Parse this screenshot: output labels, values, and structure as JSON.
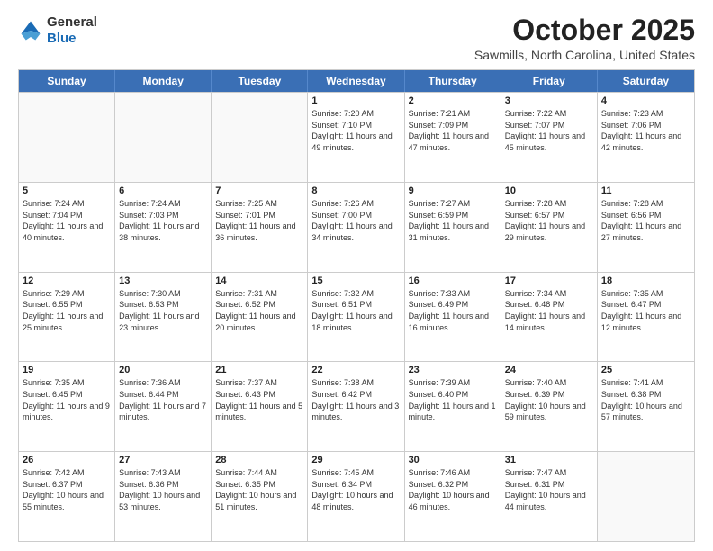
{
  "header": {
    "logo_general": "General",
    "logo_blue": "Blue",
    "month_title": "October 2025",
    "location": "Sawmills, North Carolina, United States"
  },
  "days_of_week": [
    "Sunday",
    "Monday",
    "Tuesday",
    "Wednesday",
    "Thursday",
    "Friday",
    "Saturday"
  ],
  "rows": [
    [
      {
        "day": "",
        "text": ""
      },
      {
        "day": "",
        "text": ""
      },
      {
        "day": "",
        "text": ""
      },
      {
        "day": "1",
        "text": "Sunrise: 7:20 AM\nSunset: 7:10 PM\nDaylight: 11 hours and 49 minutes."
      },
      {
        "day": "2",
        "text": "Sunrise: 7:21 AM\nSunset: 7:09 PM\nDaylight: 11 hours and 47 minutes."
      },
      {
        "day": "3",
        "text": "Sunrise: 7:22 AM\nSunset: 7:07 PM\nDaylight: 11 hours and 45 minutes."
      },
      {
        "day": "4",
        "text": "Sunrise: 7:23 AM\nSunset: 7:06 PM\nDaylight: 11 hours and 42 minutes."
      }
    ],
    [
      {
        "day": "5",
        "text": "Sunrise: 7:24 AM\nSunset: 7:04 PM\nDaylight: 11 hours and 40 minutes."
      },
      {
        "day": "6",
        "text": "Sunrise: 7:24 AM\nSunset: 7:03 PM\nDaylight: 11 hours and 38 minutes."
      },
      {
        "day": "7",
        "text": "Sunrise: 7:25 AM\nSunset: 7:01 PM\nDaylight: 11 hours and 36 minutes."
      },
      {
        "day": "8",
        "text": "Sunrise: 7:26 AM\nSunset: 7:00 PM\nDaylight: 11 hours and 34 minutes."
      },
      {
        "day": "9",
        "text": "Sunrise: 7:27 AM\nSunset: 6:59 PM\nDaylight: 11 hours and 31 minutes."
      },
      {
        "day": "10",
        "text": "Sunrise: 7:28 AM\nSunset: 6:57 PM\nDaylight: 11 hours and 29 minutes."
      },
      {
        "day": "11",
        "text": "Sunrise: 7:28 AM\nSunset: 6:56 PM\nDaylight: 11 hours and 27 minutes."
      }
    ],
    [
      {
        "day": "12",
        "text": "Sunrise: 7:29 AM\nSunset: 6:55 PM\nDaylight: 11 hours and 25 minutes."
      },
      {
        "day": "13",
        "text": "Sunrise: 7:30 AM\nSunset: 6:53 PM\nDaylight: 11 hours and 23 minutes."
      },
      {
        "day": "14",
        "text": "Sunrise: 7:31 AM\nSunset: 6:52 PM\nDaylight: 11 hours and 20 minutes."
      },
      {
        "day": "15",
        "text": "Sunrise: 7:32 AM\nSunset: 6:51 PM\nDaylight: 11 hours and 18 minutes."
      },
      {
        "day": "16",
        "text": "Sunrise: 7:33 AM\nSunset: 6:49 PM\nDaylight: 11 hours and 16 minutes."
      },
      {
        "day": "17",
        "text": "Sunrise: 7:34 AM\nSunset: 6:48 PM\nDaylight: 11 hours and 14 minutes."
      },
      {
        "day": "18",
        "text": "Sunrise: 7:35 AM\nSunset: 6:47 PM\nDaylight: 11 hours and 12 minutes."
      }
    ],
    [
      {
        "day": "19",
        "text": "Sunrise: 7:35 AM\nSunset: 6:45 PM\nDaylight: 11 hours and 9 minutes."
      },
      {
        "day": "20",
        "text": "Sunrise: 7:36 AM\nSunset: 6:44 PM\nDaylight: 11 hours and 7 minutes."
      },
      {
        "day": "21",
        "text": "Sunrise: 7:37 AM\nSunset: 6:43 PM\nDaylight: 11 hours and 5 minutes."
      },
      {
        "day": "22",
        "text": "Sunrise: 7:38 AM\nSunset: 6:42 PM\nDaylight: 11 hours and 3 minutes."
      },
      {
        "day": "23",
        "text": "Sunrise: 7:39 AM\nSunset: 6:40 PM\nDaylight: 11 hours and 1 minute."
      },
      {
        "day": "24",
        "text": "Sunrise: 7:40 AM\nSunset: 6:39 PM\nDaylight: 10 hours and 59 minutes."
      },
      {
        "day": "25",
        "text": "Sunrise: 7:41 AM\nSunset: 6:38 PM\nDaylight: 10 hours and 57 minutes."
      }
    ],
    [
      {
        "day": "26",
        "text": "Sunrise: 7:42 AM\nSunset: 6:37 PM\nDaylight: 10 hours and 55 minutes."
      },
      {
        "day": "27",
        "text": "Sunrise: 7:43 AM\nSunset: 6:36 PM\nDaylight: 10 hours and 53 minutes."
      },
      {
        "day": "28",
        "text": "Sunrise: 7:44 AM\nSunset: 6:35 PM\nDaylight: 10 hours and 51 minutes."
      },
      {
        "day": "29",
        "text": "Sunrise: 7:45 AM\nSunset: 6:34 PM\nDaylight: 10 hours and 48 minutes."
      },
      {
        "day": "30",
        "text": "Sunrise: 7:46 AM\nSunset: 6:32 PM\nDaylight: 10 hours and 46 minutes."
      },
      {
        "day": "31",
        "text": "Sunrise: 7:47 AM\nSunset: 6:31 PM\nDaylight: 10 hours and 44 minutes."
      },
      {
        "day": "",
        "text": ""
      }
    ]
  ]
}
